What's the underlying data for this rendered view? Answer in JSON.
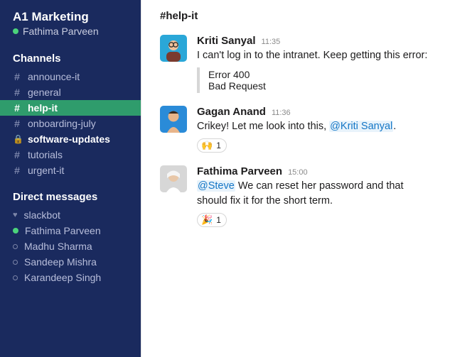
{
  "workspace": {
    "name": "A1 Marketing"
  },
  "me": {
    "name": "Fathima Parveen",
    "presence": "online"
  },
  "sidebar": {
    "channels_title": "Channels",
    "dm_title": "Direct messages",
    "channels": [
      {
        "id": "announce-it",
        "label": "announce-it",
        "prefix": "#",
        "active": false,
        "bold": false
      },
      {
        "id": "general",
        "label": "general",
        "prefix": "#",
        "active": false,
        "bold": false
      },
      {
        "id": "help-it",
        "label": "help-it",
        "prefix": "#",
        "active": true,
        "bold": true
      },
      {
        "id": "onboarding-july",
        "label": "onboarding-july",
        "prefix": "#",
        "active": false,
        "bold": false
      },
      {
        "id": "software-updates",
        "label": "software-updates",
        "prefix": "lock",
        "active": false,
        "bold": true
      },
      {
        "id": "tutorials",
        "label": "tutorials",
        "prefix": "#",
        "active": false,
        "bold": false
      },
      {
        "id": "urgent-it",
        "label": "urgent-it",
        "prefix": "#",
        "active": false,
        "bold": false
      }
    ],
    "dms": [
      {
        "id": "slackbot",
        "label": "slackbot",
        "presence": "heart"
      },
      {
        "id": "fathima",
        "label": "Fathima Parveen",
        "presence": "online"
      },
      {
        "id": "madhu",
        "label": "Madhu Sharma",
        "presence": "offline"
      },
      {
        "id": "sandeep",
        "label": "Sandeep Mishra",
        "presence": "offline"
      },
      {
        "id": "karandeep",
        "label": "Karandeep Singh",
        "presence": "offline"
      }
    ]
  },
  "channel_header": {
    "name": "#help-it"
  },
  "messages": [
    {
      "author": "Kriti Sanyal",
      "time": "11:35",
      "text": "I can't log in to the intranet. Keep getting this error:",
      "quote": [
        "Error 400",
        "Bad Request"
      ],
      "reactions": []
    },
    {
      "author": "Gagan Anand",
      "time": "11:36",
      "text_parts": [
        {
          "t": "Crikey! Let me look into this, "
        },
        {
          "mention": "@Kriti Sanyal"
        },
        {
          "t": "."
        }
      ],
      "reactions": [
        {
          "emoji": "🙌",
          "count": 1
        }
      ]
    },
    {
      "author": "Fathima Parveen",
      "time": "15:00",
      "text_parts": [
        {
          "mention": "@Steve"
        },
        {
          "t": " We can reset her password and that should fix it for the short term."
        }
      ],
      "reactions": [
        {
          "emoji": "🎉",
          "count": 1
        }
      ]
    }
  ],
  "colors": {
    "sidebar_bg": "#1a2a5e",
    "active_bg": "#2f9c6c",
    "mention_bg": "#e8f3fb",
    "mention_fg": "#1476c6"
  }
}
